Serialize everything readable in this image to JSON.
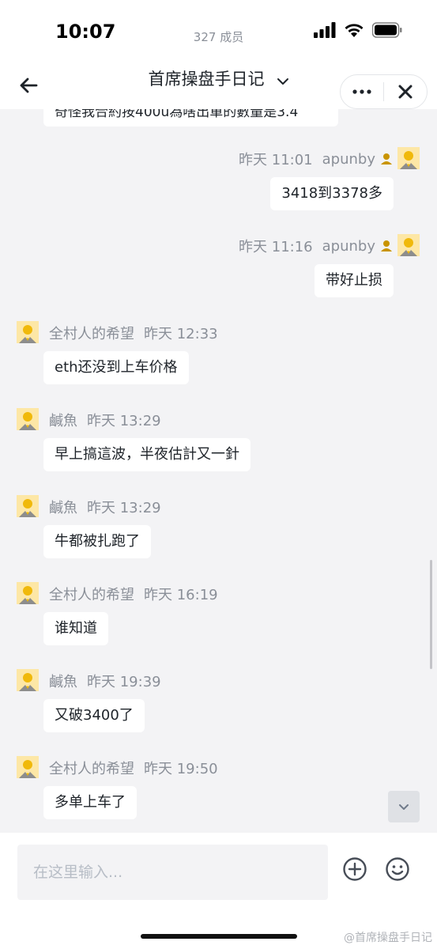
{
  "status_bar": {
    "time": "10:07"
  },
  "header": {
    "title": "首席操盘手日记",
    "member_count": "327 成员",
    "icons": {
      "back": "back-arrow-icon",
      "dropdown": "chevron-down-icon",
      "more": "more-icon",
      "close": "close-icon"
    }
  },
  "chat": {
    "partial_top_message": "奇怪我合約按400u為啥出單的數量是3.4",
    "messages": [
      {
        "side": "right",
        "sender": "apunby",
        "time": "昨天 11:01",
        "text": "3418到3378多",
        "badge": true
      },
      {
        "side": "right",
        "sender": "apunby",
        "time": "昨天 11:16",
        "text": "带好止损",
        "badge": true
      },
      {
        "side": "left",
        "sender": "全村人的希望",
        "time": "昨天 12:33",
        "text": "eth还没到上车价格"
      },
      {
        "side": "left",
        "sender": "鹹魚",
        "time": "昨天 13:29",
        "text": "早上搞這波，半夜估計又一針"
      },
      {
        "side": "left",
        "sender": "鹹魚",
        "time": "昨天 13:29",
        "text": "牛都被扎跑了"
      },
      {
        "side": "left",
        "sender": "全村人的希望",
        "time": "昨天 16:19",
        "text": "谁知道"
      },
      {
        "side": "left",
        "sender": "鹹魚",
        "time": "昨天 19:39",
        "text": "又破3400了"
      },
      {
        "side": "left",
        "sender": "全村人的希望",
        "time": "昨天 19:50",
        "text": "多单上车了"
      }
    ]
  },
  "input": {
    "placeholder": "在这里输入...",
    "icons": {
      "add": "plus-circle-icon",
      "emoji": "emoji-icon"
    }
  },
  "watermark": "@首席操盘手日记",
  "colors": {
    "accent_yellow": "#f0b90b",
    "background": "#f3f3f5",
    "text_primary": "#1e2329",
    "text_secondary": "#8a8f98"
  }
}
